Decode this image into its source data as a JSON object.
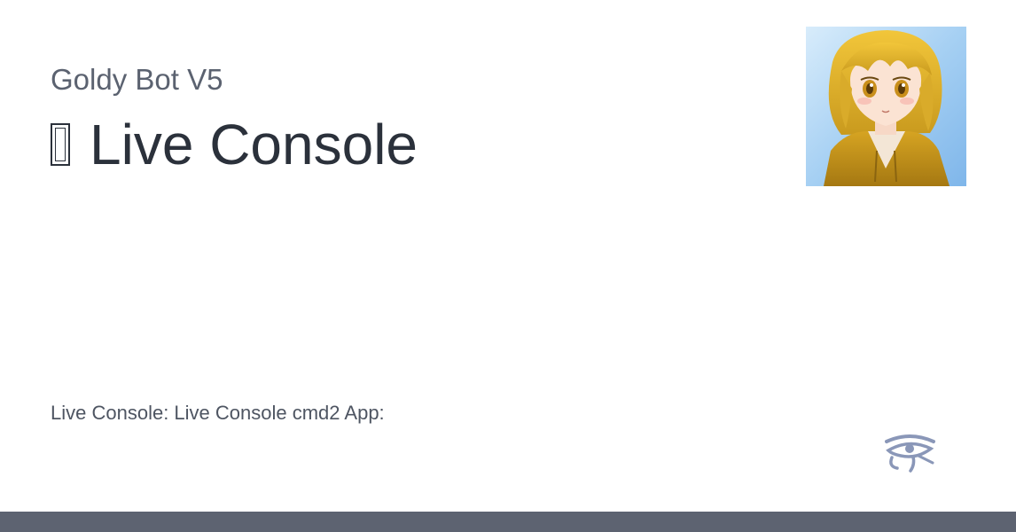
{
  "header": {
    "site_name": "Goldy Bot V5",
    "title": "Live Console",
    "title_icon": "missing-glyph-icon"
  },
  "description": "Live Console: Live Console cmd2 App:",
  "images": {
    "avatar": "anime-girl-avatar",
    "logo": "eye-of-horus-icon"
  },
  "colors": {
    "site_name": "#5b6270",
    "title": "#2b313b",
    "description": "#4e5562",
    "logo": "#8a97b8",
    "bottom_bar": "#5d6371"
  }
}
